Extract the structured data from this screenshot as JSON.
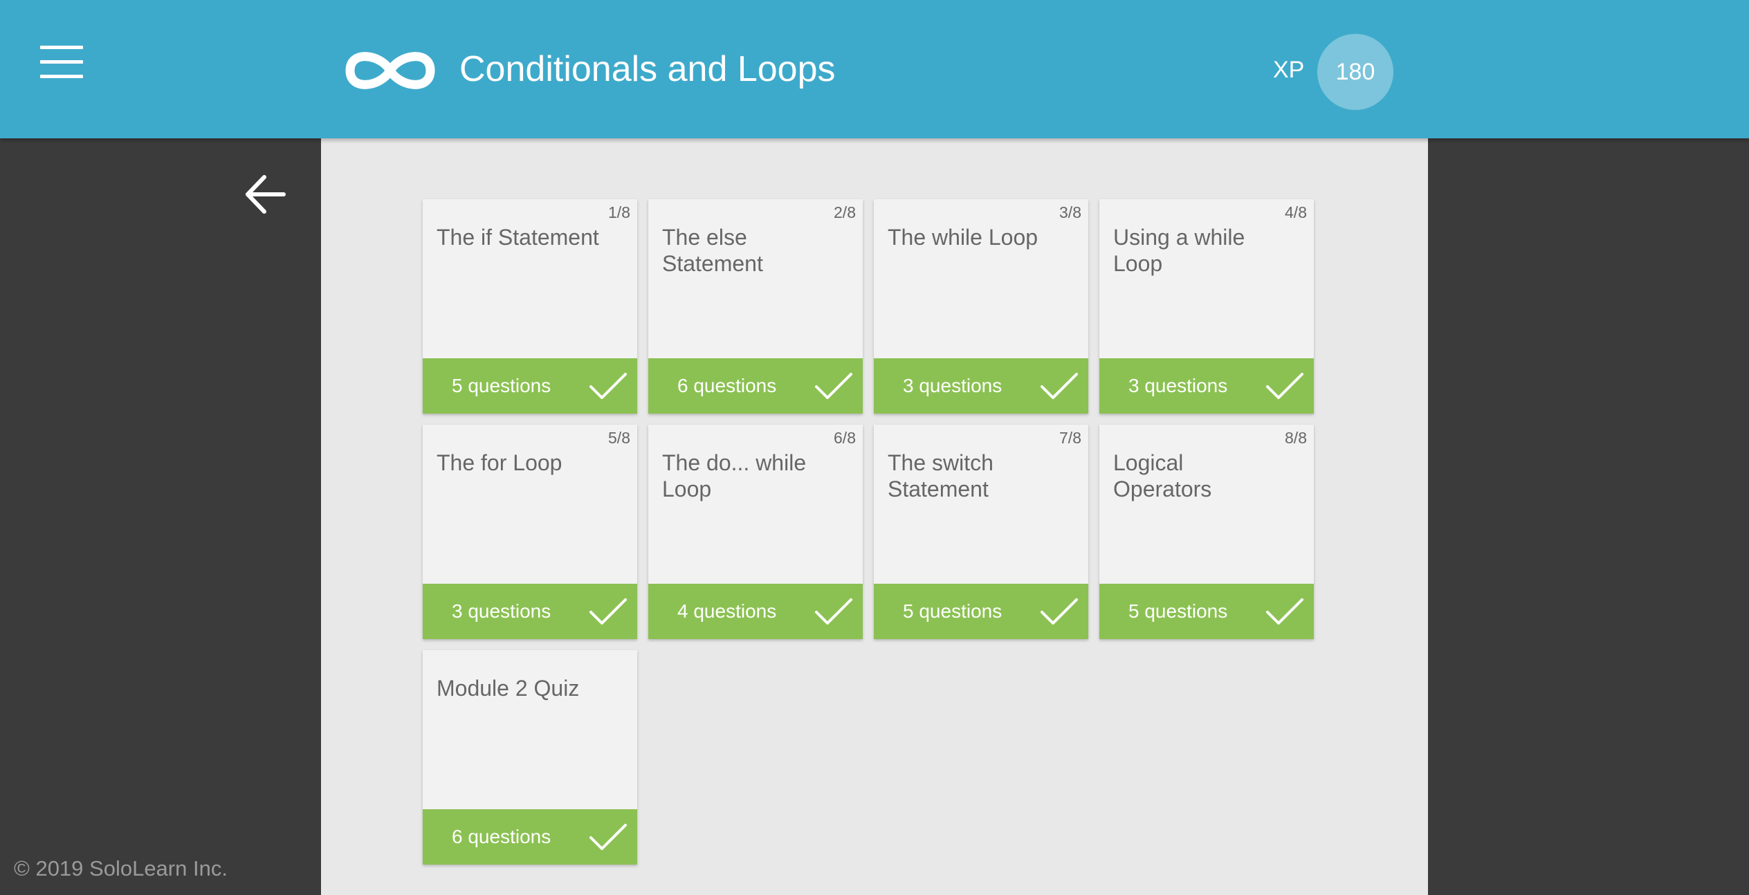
{
  "header": {
    "title": "Conditionals and Loops",
    "xp_label": "XP",
    "xp_value": "180",
    "menu_icon": "hamburger-menu-icon",
    "logo_icon": "infinity-logo-icon"
  },
  "nav": {
    "back_icon": "arrow-left-icon"
  },
  "lessons": [
    {
      "num": "1/8",
      "title": "The if Statement",
      "questions": "5 questions",
      "completed": true
    },
    {
      "num": "2/8",
      "title": "The else Statement",
      "questions": "6 questions",
      "completed": true
    },
    {
      "num": "3/8",
      "title": "The while Loop",
      "questions": "3 questions",
      "completed": true
    },
    {
      "num": "4/8",
      "title": "Using a while Loop",
      "questions": "3 questions",
      "completed": true
    },
    {
      "num": "5/8",
      "title": "The for Loop",
      "questions": "3 questions",
      "completed": true
    },
    {
      "num": "6/8",
      "title": "The do... while Loop",
      "questions": "4 questions",
      "completed": true
    },
    {
      "num": "7/8",
      "title": "The switch Statement",
      "questions": "5 questions",
      "completed": true
    },
    {
      "num": "8/8",
      "title": "Logical Operators",
      "questions": "5 questions",
      "completed": true
    },
    {
      "num": "",
      "title": "Module 2 Quiz",
      "questions": "6 questions",
      "completed": true
    }
  ],
  "footer": {
    "copyright": "© 2019 SoloLearn Inc."
  },
  "colors": {
    "header_bg": "#3eaacb",
    "xp_badge_bg": "#7dc5dc",
    "side_bg": "#3b3b3b",
    "content_bg": "#e8e8e8",
    "card_bg": "#f2f2f2",
    "complete_green": "#8bc152"
  }
}
